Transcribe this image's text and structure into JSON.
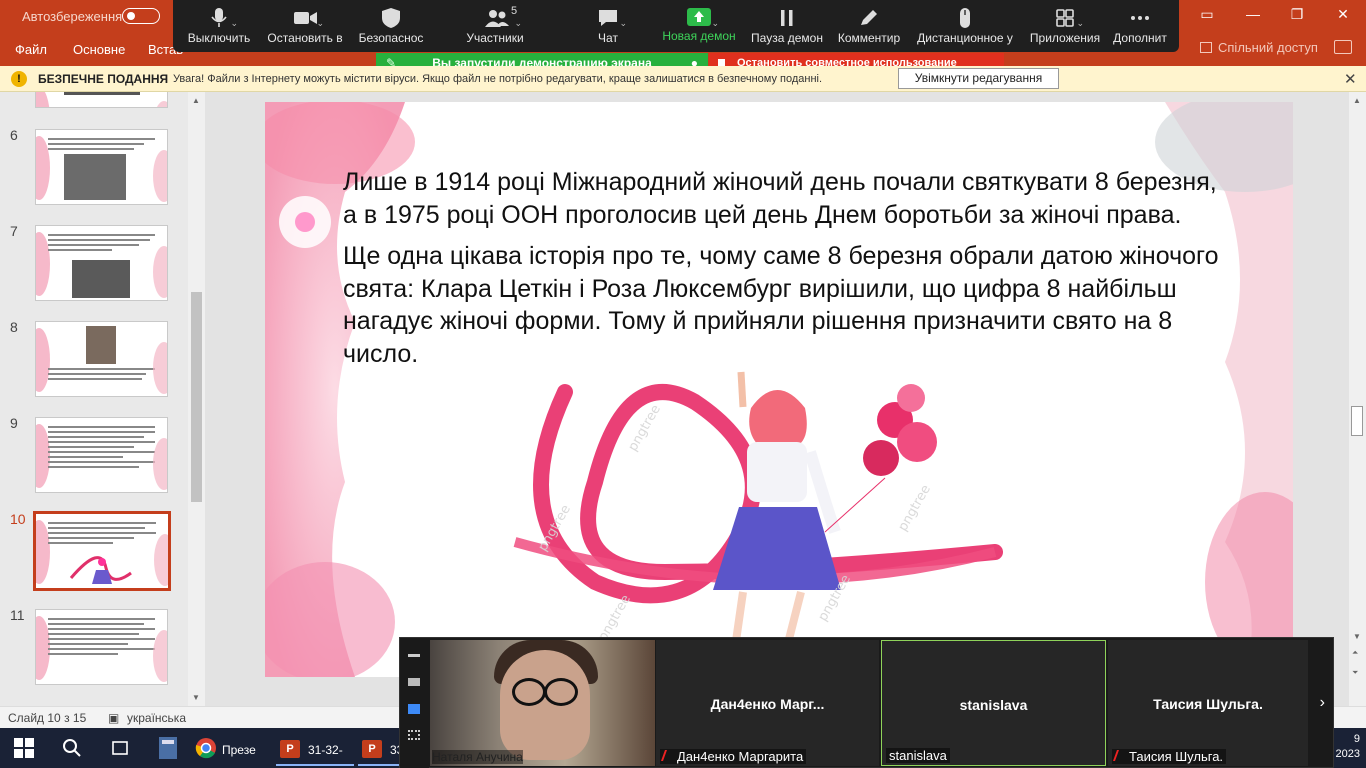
{
  "powerpoint": {
    "autosave_label": "Автозбереження",
    "tabs": [
      "Файл",
      "Основне",
      "Встав"
    ],
    "share_label": "Спільний доступ"
  },
  "zoom_toolbar": {
    "buttons": [
      {
        "label": "Выключить",
        "icon": "microphone-icon"
      },
      {
        "label": "Остановить в",
        "icon": "video-camera-icon"
      },
      {
        "label": "Безопаснос",
        "icon": "shield-icon"
      },
      {
        "label": "Участники",
        "icon": "participants-icon"
      },
      {
        "label": "Чат",
        "icon": "chat-icon"
      },
      {
        "label": "Новая демон",
        "icon": "share-screen-icon"
      },
      {
        "label": "Пауза демон",
        "icon": "pause-icon"
      },
      {
        "label": "Комментир",
        "icon": "annotate-pen-icon"
      },
      {
        "label": "Дистанционное у",
        "icon": "mouse-icon"
      },
      {
        "label": "Приложения",
        "icon": "apps-icon"
      },
      {
        "label": "Дополнит",
        "icon": "more-icon"
      }
    ],
    "participants_count": "5",
    "share_banner": "Вы запустили демонстрацию экрана",
    "stop_banner": "Остановить совместное использование",
    "accent": "#2dbb4a",
    "stop_color": "#e0301e"
  },
  "protected_view": {
    "title": "БЕЗПЕЧНЕ ПОДАННЯ",
    "message": "Увага! Файли з Інтернету можуть містити віруси. Якщо файл не потрібно редагувати, краще залишатися в безпечному поданні.",
    "enable_button": "Увімкнути редагування"
  },
  "thumbnails": {
    "numbers": [
      "6",
      "7",
      "8",
      "9",
      "10",
      "11"
    ],
    "selected": "10"
  },
  "slide": {
    "paragraph1": "Лише в 1914 році Міжнародний жіночий день почали святкувати  8 березня, а в 1975 році ООН проголосив цей день Днем боротьби за жіночі права.",
    "paragraph2": "Ще одна цікава історія про те, чому саме 8 березня обрали датою жіночого свята: Клара Цеткін і Роза Люксембург вирішили, що цифра 8 найбільш нагадує жіночі форми. Тому й прийняли рішення призначити свято на 8 число.",
    "watermark": "pngtree"
  },
  "status_bar": {
    "slide_info": "Слайд 10 з 15",
    "language": "українська"
  },
  "taskbar": {
    "apps": [
      "Презе",
      "31-32-",
      "33"
    ],
    "year": "2023",
    "day": "9"
  },
  "zoom_gallery": {
    "self_name": "Наталя Анучина",
    "participants": [
      {
        "tile_name": "Дан4енко  Марг...",
        "footer": "Дан4енко Маргарита",
        "muted": true
      },
      {
        "tile_name": "stanislava",
        "footer": "stanislava",
        "muted": false
      },
      {
        "tile_name": "Таисия Шульга.",
        "footer": "Таисия Шульга.",
        "muted": true
      }
    ]
  }
}
